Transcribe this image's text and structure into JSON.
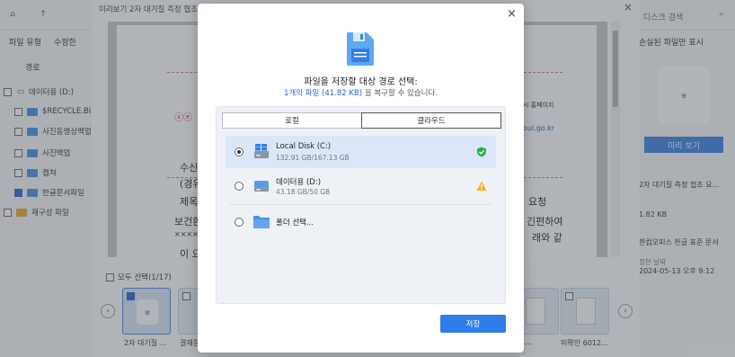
{
  "app": {
    "search_placeholder": "디스크 검색",
    "filter_label": "파일 유형",
    "modified_label": "수정한",
    "tab_path": "경로",
    "show_lost_files": "손실된 파일만 표시",
    "tree": [
      {
        "label": "데이터용 (D:)",
        "checked": false
      },
      {
        "label": "$RECYCLE.BIN",
        "checked": false
      },
      {
        "label": "사진동영상백업",
        "checked": false
      },
      {
        "label": "사진백업",
        "checked": false
      },
      {
        "label": "캡쳐",
        "checked": false
      },
      {
        "label": "한글문서파일",
        "checked": true
      },
      {
        "label": "재구성 파일",
        "checked": false
      }
    ],
    "right_panel": {
      "preview_button": "미리 보기",
      "file_name": "2자 대기질 측정 협조 요...",
      "size": "1.82 KB",
      "type": "한컴오피스 한글 표준 문서",
      "date_label": "정한 날짜",
      "date": "2024-05-13 오후 9:12"
    }
  },
  "preview": {
    "title": "미리보기 2자 대기질 측정 협조",
    "doc_lines": [
      "수신",
      "(경유",
      "제목",
      "보건환",
      "이 요청",
      "××××××"
    ],
    "doc_right": [
      "시 홍페이지",
      "oul.go.kr",
      "요청",
      "긴편하여",
      "래와 같"
    ],
    "select_all": "모두 선택(1/17)",
    "thumbnails": [
      {
        "label": "2자 대기질 ...",
        "selected": true,
        "checked": true
      },
      {
        "label": "결재문...",
        "selected": false,
        "checked": false
      },
      {
        "label": "3451...",
        "selected": false,
        "checked": false
      },
      {
        "label": "미확인 6012...",
        "selected": false,
        "checked": false
      }
    ]
  },
  "dialog": {
    "heading": "파일을 저장할 대상 경로 선택:",
    "sub_count": "1개의 파일 (41.82 KB)",
    "sub_rest": "을 복구할 수 있습니다.",
    "tabs": [
      "로컬",
      "클라우드"
    ],
    "options": [
      {
        "name": "Local Disk (C:)",
        "size": "132.91 GB/167.13 GB",
        "selected": true,
        "status": "ok"
      },
      {
        "name": "데이터용 (D:)",
        "size": "43.18 GB/50 GB",
        "selected": false,
        "status": "warning"
      },
      {
        "name": "폴더 선택...",
        "size": "",
        "selected": false,
        "status": ""
      }
    ],
    "save_label": "저장"
  },
  "colors": {
    "accent": "#2f7de8",
    "ok": "#21b24b",
    "warning": "#f2b31b"
  }
}
